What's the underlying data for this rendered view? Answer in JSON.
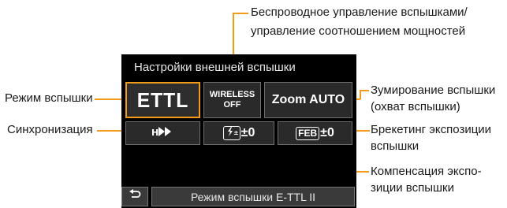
{
  "screen": {
    "title": "Настройки внешней вспышки",
    "flash_mode_value": "ETTL",
    "wireless_line1": "WIRELESS",
    "wireless_line2": "OFF",
    "zoom_value": "Zoom AUTO",
    "sync_icon": "high-speed-sync-icon",
    "fec_badge": "±",
    "fec_value": "±0",
    "feb_badge": "FEB",
    "feb_value": "±0",
    "back_icon": "return-icon",
    "status_text": "Режим вспышки E-TTL II"
  },
  "callouts": {
    "wireless_line1": "Беспроводное управление вспышками/",
    "wireless_line2": "управление соотношением мощностей",
    "flash_mode": "Режим вспышки",
    "sync": "Синхронизация",
    "zoom_line1": "Зумирование вспышки",
    "zoom_line2": "(охват вспышки)",
    "feb_line1": "Брекетинг экспозиции",
    "feb_line2": "вспышки",
    "fec_line1": "Компенсация экспо-",
    "fec_line2": "зиции вспышки"
  },
  "colors": {
    "accent": "#f29a1a",
    "screen_bg": "#000000"
  }
}
